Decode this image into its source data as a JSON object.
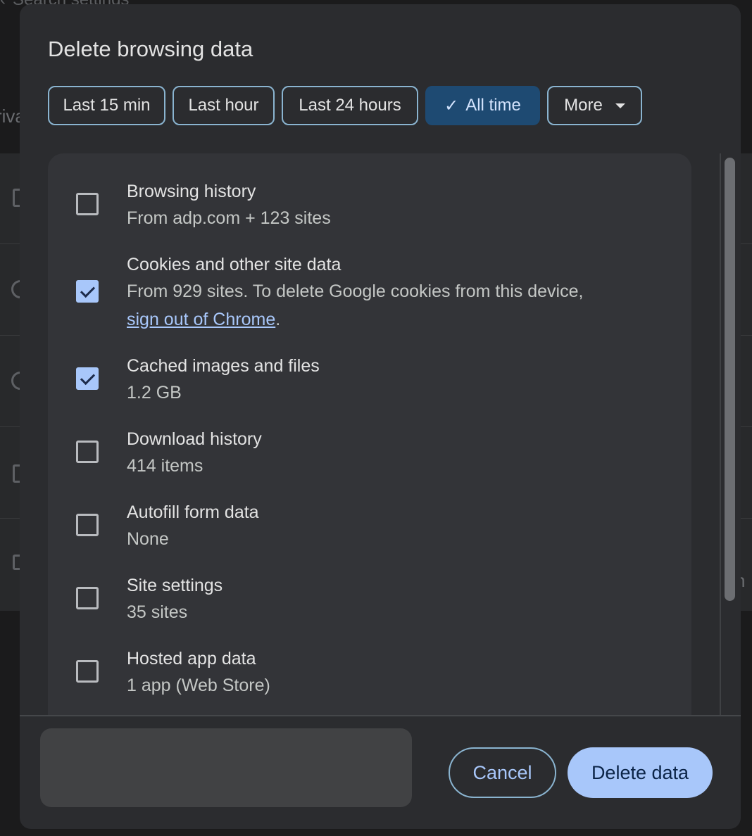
{
  "background": {
    "search_label": "Search settings",
    "left_fragment": "riva",
    "right_fragment": "n"
  },
  "dialog": {
    "title": "Delete browsing data",
    "time_ranges": [
      {
        "label": "Last 15 min",
        "selected": false
      },
      {
        "label": "Last hour",
        "selected": false
      },
      {
        "label": "Last 24 hours",
        "selected": false
      },
      {
        "label": "All time",
        "selected": true
      },
      {
        "label": "More",
        "selected": false
      }
    ],
    "items": [
      {
        "title": "Browsing history",
        "subtitle": "From adp.com + 123 sites",
        "checked": false
      },
      {
        "title": "Cookies and other site data",
        "subtitle": "From 929 sites. To delete Google cookies from this device,",
        "link": "sign out of Chrome",
        "link_suffix": ".",
        "checked": true
      },
      {
        "title": "Cached images and files",
        "subtitle": "1.2 GB",
        "checked": true
      },
      {
        "title": "Download history",
        "subtitle": "414 items",
        "checked": false
      },
      {
        "title": "Autofill form data",
        "subtitle": "None",
        "checked": false
      },
      {
        "title": "Site settings",
        "subtitle": "35 sites",
        "checked": false
      },
      {
        "title": "Hosted app data",
        "subtitle": "1 app (Web Store)",
        "checked": false
      }
    ],
    "cancel_label": "Cancel",
    "delete_label": "Delete data"
  },
  "colors": {
    "accent": "#a8c7fa",
    "selected_chip": "#1e4a72",
    "dialog_bg": "#2b2c2f",
    "panel_bg": "#333438"
  }
}
